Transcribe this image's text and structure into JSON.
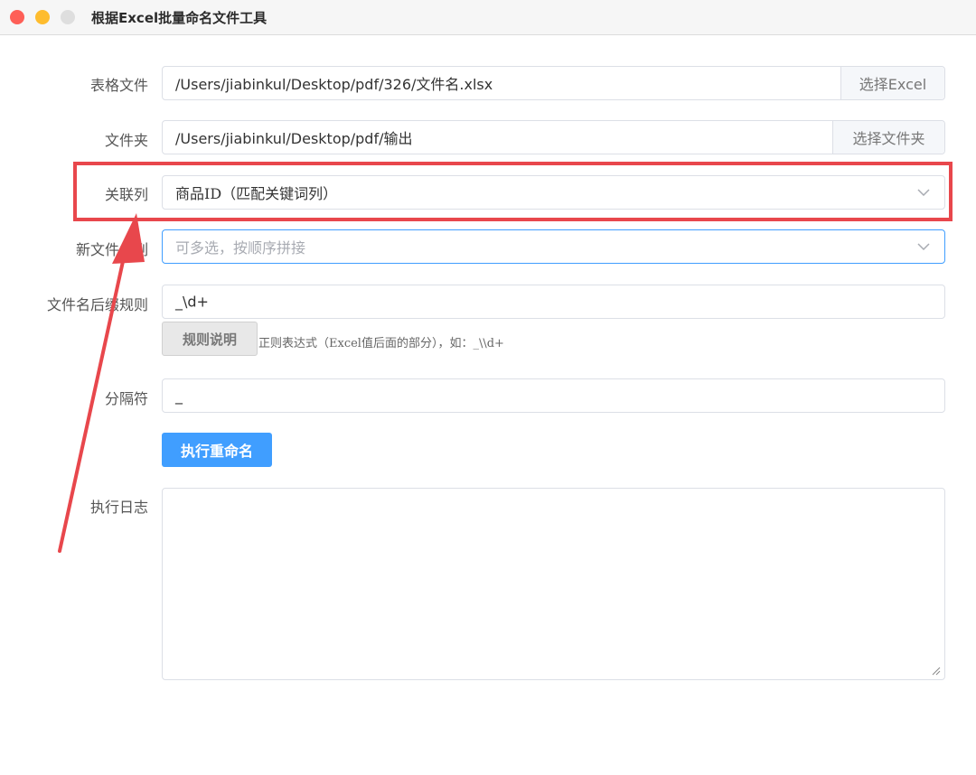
{
  "window": {
    "title": "根据Excel批量命名文件工具"
  },
  "form": {
    "excel_file": {
      "label": "表格文件",
      "value": "/Users/jiabinkul/Desktop/pdf/326/文件名.xlsx",
      "button": "选择Excel"
    },
    "folder": {
      "label": "文件夹",
      "value": "/Users/jiabinkul/Desktop/pdf/输出",
      "button": "选择文件夹"
    },
    "key_column": {
      "label": "关联列",
      "value": "商品ID（匹配关键词列）"
    },
    "new_name_columns": {
      "label": "新文件名列",
      "placeholder": "可多选，按顺序拼接"
    },
    "suffix_rule": {
      "label": "文件名后缀规则",
      "value": "_\\d+",
      "help_button": "规则说明",
      "hint": "正则表达式（Excel值后面的部分），如：_\\\\d+"
    },
    "separator": {
      "label": "分隔符",
      "value": "_"
    },
    "run_button": "执行重命名",
    "log": {
      "label": "执行日志",
      "value": ""
    }
  },
  "colors": {
    "accent": "#409eff",
    "highlight": "#e8474c",
    "border": "#dcdfe6"
  },
  "icons": {
    "dropdown": "chevron-down-icon",
    "resize": "resize-grip-icon"
  }
}
